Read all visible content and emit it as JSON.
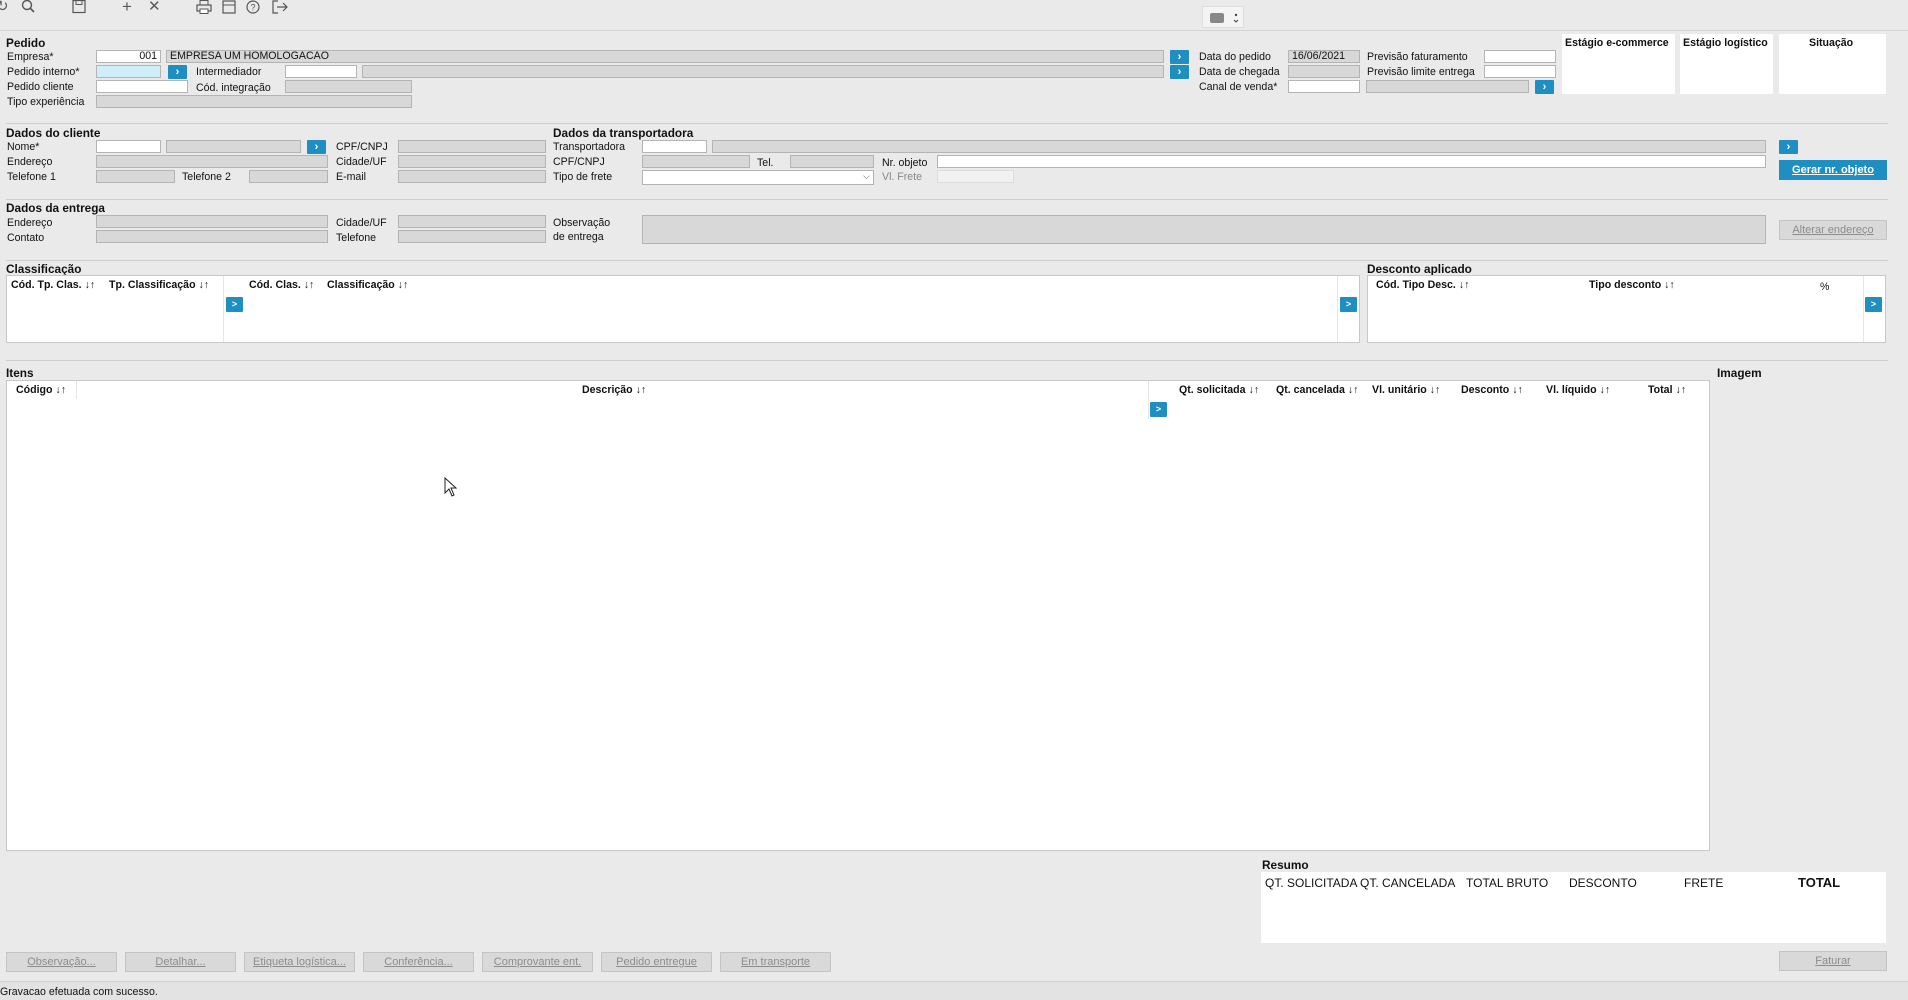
{
  "toolbar": {
    "refresh_icon": "refresh-icon",
    "search_icon": "search-icon",
    "save_icon": "save-icon",
    "add_icon": "plus-icon",
    "delete_icon": "close-icon",
    "print_icon": "printer-icon",
    "calendar_icon": "calendar-icon",
    "help_icon": "help-icon",
    "exit_icon": "exit-icon"
  },
  "pedido": {
    "title": "Pedido",
    "empresa_label": "Empresa*",
    "empresa_code": "001",
    "empresa_name": "EMPRESA UM HOMOLOGACAO",
    "pedido_interno_label": "Pedido interno*",
    "intermediador_label": "Intermediador",
    "pedido_cliente_label": "Pedido cliente",
    "cod_integracao_label": "Cód. integração",
    "tipo_experiencia_label": "Tipo experiência",
    "data_pedido_label": "Data do pedido",
    "data_pedido": "16/06/2021",
    "data_chegada_label": "Data de chegada",
    "canal_venda_label": "Canal de venda*",
    "previsao_faturamento_label": "Previsão faturamento",
    "previsao_limite_label": "Previsão limite entrega"
  },
  "status_headers": {
    "ecommerce": "Estágio e-commerce",
    "logistico": "Estágio logístico",
    "situacao": "Situação"
  },
  "cliente": {
    "title": "Dados do cliente",
    "nome_label": "Nome*",
    "endereco_label": "Endereço",
    "telefone1_label": "Telefone 1",
    "telefone2_label": "Telefone 2",
    "cpf_label": "CPF/CNPJ",
    "cidade_label": "Cidade/UF",
    "email_label": "E-mail"
  },
  "transportadora": {
    "title": "Dados da transportadora",
    "transportadora_label": "Transportadora",
    "cpf_label": "CPF/CNPJ",
    "tel_label": "Tel.",
    "nr_objeto_label": "Nr. objeto",
    "tipo_frete_label": "Tipo de frete",
    "vl_frete_label": "Vl. Frete",
    "gerar_button": "Gerar nr. objeto"
  },
  "entrega": {
    "title": "Dados da entrega",
    "endereco_label": "Endereço",
    "contato_label": "Contato",
    "cidade_label": "Cidade/UF",
    "telefone_label": "Telefone",
    "obs_label_1": "Observação",
    "obs_label_2": "de entrega",
    "alterar_button": "Alterar endereço"
  },
  "classificacao": {
    "title": "Classificação",
    "columns": [
      "Cód. Tp. Clas. ↓↑",
      "Tp. Classificação ↓↑",
      "Cód. Clas. ↓↑",
      "Classificação ↓↑"
    ]
  },
  "desconto": {
    "title": "Desconto aplicado",
    "columns": [
      "Cód. Tipo Desc. ↓↑",
      "Tipo desconto ↓↑",
      "%"
    ]
  },
  "itens": {
    "title": "Itens",
    "columns": [
      "Código ↓↑",
      "Descrição ↓↑",
      "Qt. solicitada ↓↑",
      "Qt. cancelada ↓↑",
      "Vl. unitário ↓↑",
      "Desconto ↓↑",
      "Vl. líquido ↓↑",
      "Total ↓↑"
    ]
  },
  "imagem": {
    "title": "Imagem"
  },
  "resumo": {
    "title": "Resumo",
    "columns": [
      "QT. SOLICITADA",
      "QT. CANCELADA",
      "TOTAL BRUTO",
      "DESCONTO",
      "FRETE",
      "TOTAL"
    ]
  },
  "buttons": [
    "Observação...",
    "Detalhar...",
    "Etiqueta logística...",
    "Conferência...",
    "Comprovante ent.",
    "Pedido entregue",
    "Em transporte"
  ],
  "faturar_button": "Faturar",
  "status_bar": "Gravacao efetuada com sucesso.",
  "colors": {
    "accent": "#1f8fc2",
    "background": "#eaeaea",
    "disabled_field": "#d8d8d8"
  }
}
